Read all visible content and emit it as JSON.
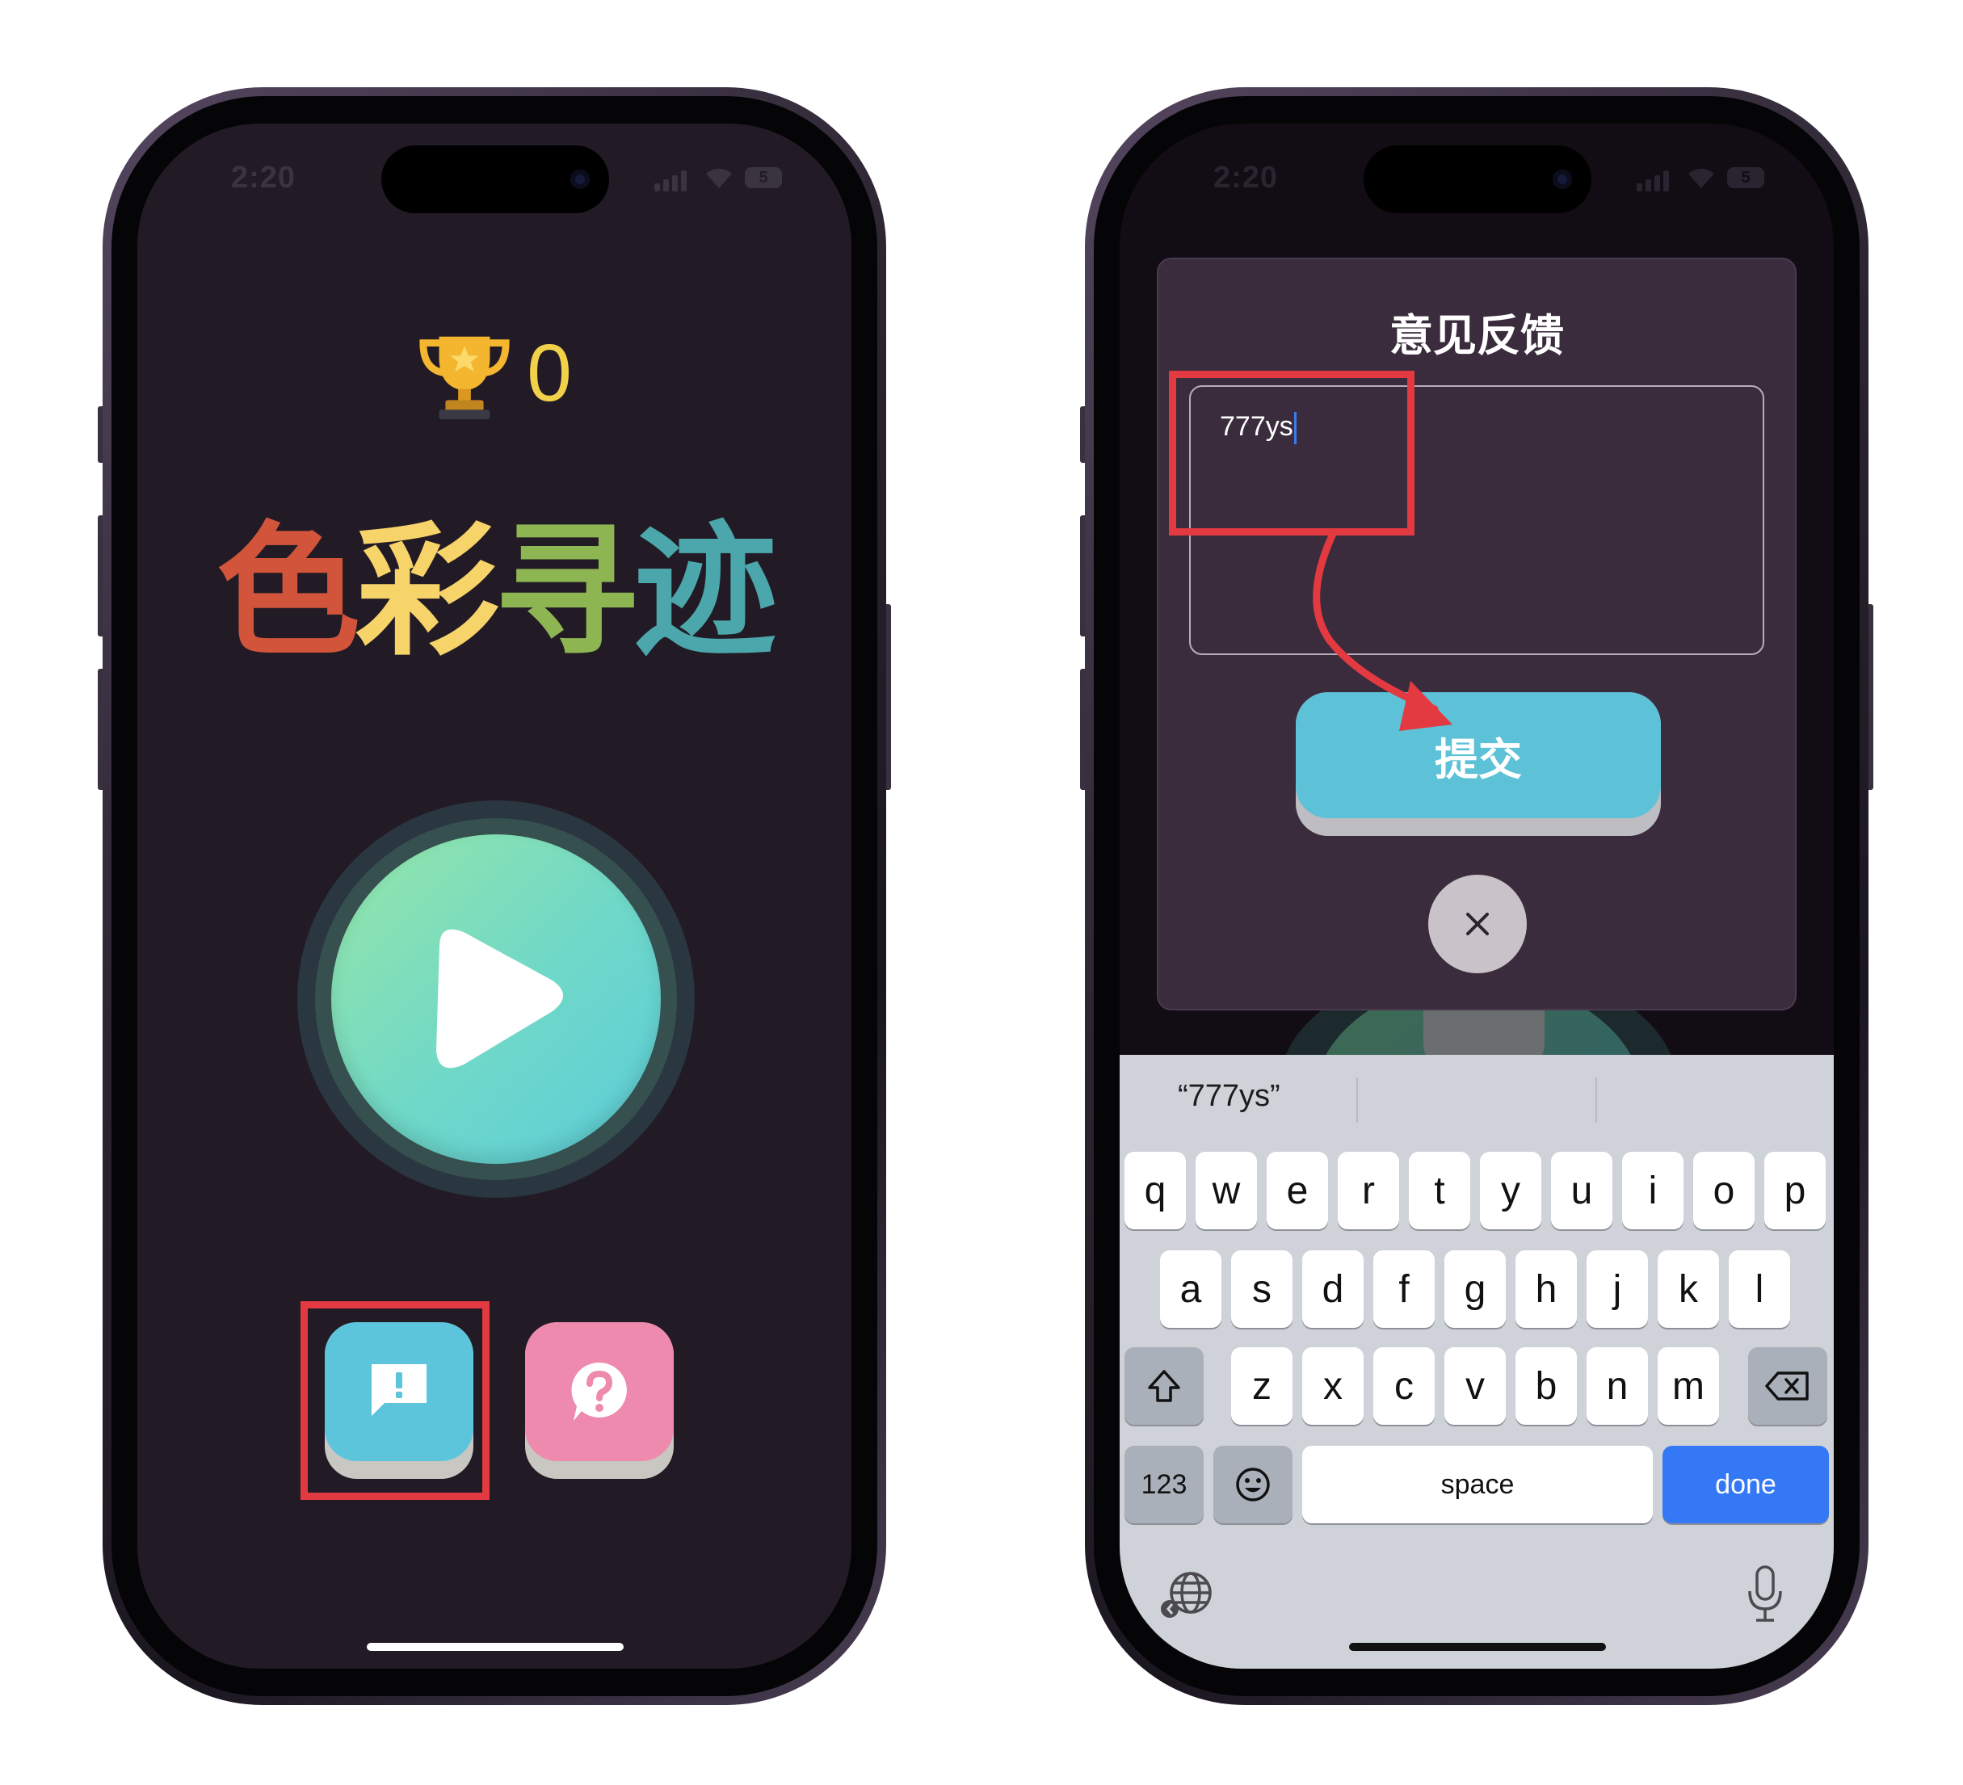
{
  "status_bar": {
    "time": "2:20",
    "battery": "5"
  },
  "game": {
    "trophy_icon": "trophy-icon",
    "score": "0",
    "title_chars": [
      {
        "char": "色",
        "color": "#d2553b"
      },
      {
        "char": "彩",
        "color": "#f6d469"
      },
      {
        "char": "寻",
        "color": "#8db552"
      },
      {
        "char": "迹",
        "color": "#4ba7ab"
      }
    ],
    "play_icon": "play-icon",
    "feedback_icon": "feedback-icon",
    "help_icon": "help-icon",
    "colors": {
      "background": "#221b26",
      "feedback_tile": "#5cc5dc",
      "help_tile": "#ee8aae",
      "highlight": "#e23a40"
    }
  },
  "feedback_dialog": {
    "title": "意见反馈",
    "input_value": "777ys",
    "submit_label": "提交",
    "close_icon": "close-icon"
  },
  "keyboard": {
    "suggestion": "“777ys”",
    "row1": [
      "q",
      "w",
      "e",
      "r",
      "t",
      "y",
      "u",
      "i",
      "o",
      "p"
    ],
    "row2": [
      "a",
      "s",
      "d",
      "f",
      "g",
      "h",
      "j",
      "k",
      "l"
    ],
    "row3": [
      "z",
      "x",
      "c",
      "v",
      "b",
      "n",
      "m"
    ],
    "numbers_label": "123",
    "space_label": "space",
    "done_label": "done",
    "shift_icon": "shift-icon",
    "delete_icon": "delete-icon",
    "emoji_icon": "emoji-icon",
    "globe_icon": "globe-icon",
    "mic_icon": "microphone-icon"
  }
}
